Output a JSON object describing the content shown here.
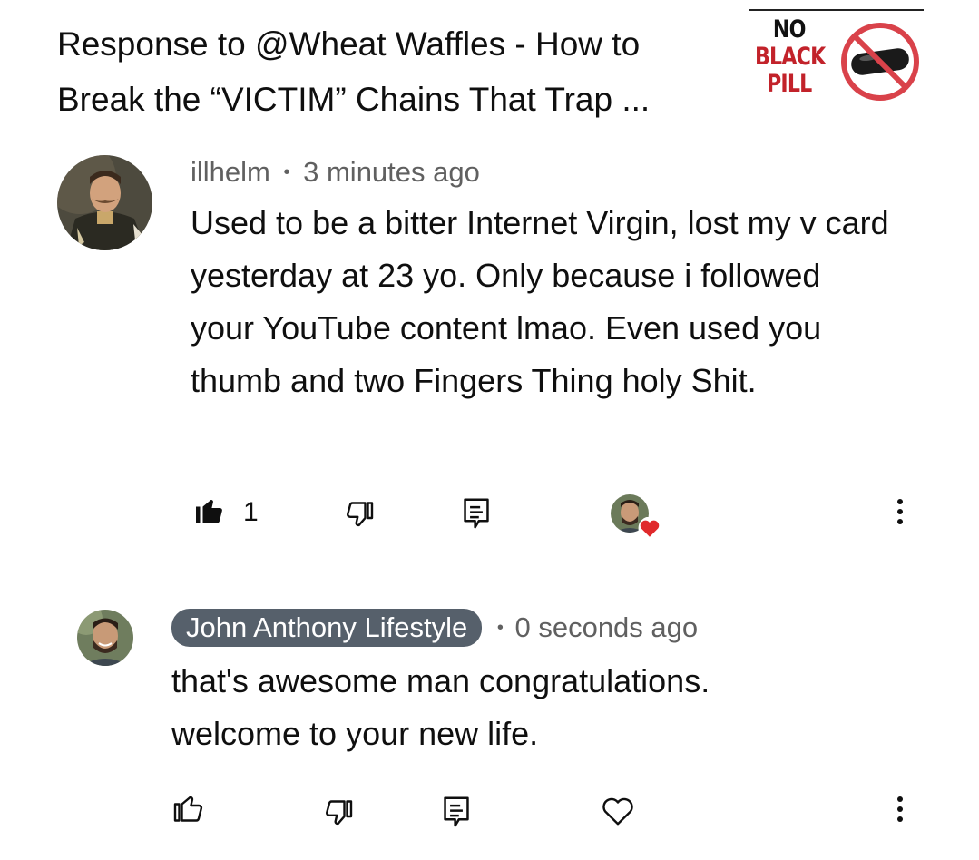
{
  "video": {
    "title": "Response to @Wheat Waffles - How to Break the “VICTIM” Chains That Trap ...",
    "thumbnail_text": [
      "NO",
      "BLACK",
      "PILL"
    ]
  },
  "comments": [
    {
      "author": "illhelm",
      "separator": "•",
      "time": "3 minutes ago",
      "text": "Used to be a bitter Internet Virgin, lost my v card yesterday at 23 yo. Only because i followed your YouTube content lmao. Even used you thumb and two Fingers Thing holy Shit.",
      "like_count": "1",
      "liked": true,
      "creator_hearted": true
    },
    {
      "author": "John Anthony Lifestyle",
      "separator": "•",
      "time": "0 seconds ago",
      "text": "that's awesome man congratulations. welcome to your new life.",
      "is_creator": true
    }
  ],
  "icons": {
    "like": "thumbs-up-icon",
    "dislike": "thumbs-down-icon",
    "reply": "reply-icon",
    "heart": "heart-icon",
    "more": "more-vertical-icon"
  },
  "colors": {
    "heart": "#e0292b",
    "pill_bg": "#56606b",
    "meta_text": "#606060"
  }
}
